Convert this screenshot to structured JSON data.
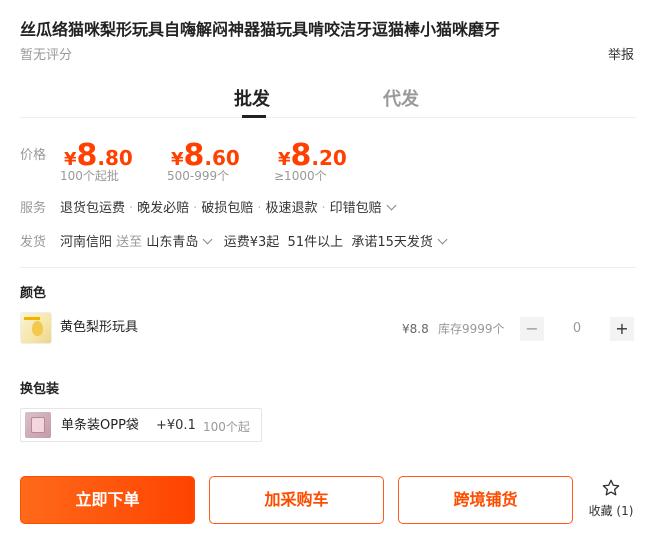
{
  "product": {
    "title": "丝瓜络猫咪梨形玩具自嗨解闷神器猫玩具啃咬洁牙逗猫棒小猫咪磨牙",
    "rating_text": "暂无评分",
    "report_label": "举报"
  },
  "tabs": [
    {
      "label": "批发",
      "active": true
    },
    {
      "label": "代发",
      "active": false
    }
  ],
  "pricing": {
    "label": "价格",
    "currency_symbol": "¥",
    "tiers": [
      {
        "integer": "8",
        "decimal": ".80",
        "range": "100个起批"
      },
      {
        "integer": "8",
        "decimal": ".60",
        "range": "500-999个"
      },
      {
        "integer": "8",
        "decimal": ".20",
        "range": "≥1000个"
      }
    ],
    "accent_color": "#ff4000"
  },
  "services": {
    "label": "服务",
    "items": [
      "退货包运费",
      "晚发必赔",
      "破损包赔",
      "极速退款",
      "印错包赔"
    ],
    "separator": "·"
  },
  "shipping": {
    "label": "发货",
    "origin": "河南信阳",
    "to_label": "送至",
    "destination": "山东青岛",
    "freight": "运费¥3起",
    "freight_condition": "51件以上",
    "promise": "承诺15天发货"
  },
  "color_section": {
    "title": "颜色",
    "skus": [
      {
        "name": "黄色梨形玩具",
        "price": "¥8.8",
        "stock": "库存9999个",
        "quantity": "0"
      }
    ],
    "minus_label": "−",
    "plus_label": "+"
  },
  "packaging_section": {
    "title": "换包装",
    "options": [
      {
        "name": "单条装OPP袋",
        "price": "+¥0.1",
        "min_order": "100个起"
      }
    ]
  },
  "actions": {
    "buy_now": "立即下单",
    "add_to_cart": "加采购车",
    "cross_border": "跨境铺货",
    "favorite": "收藏 (1)"
  }
}
